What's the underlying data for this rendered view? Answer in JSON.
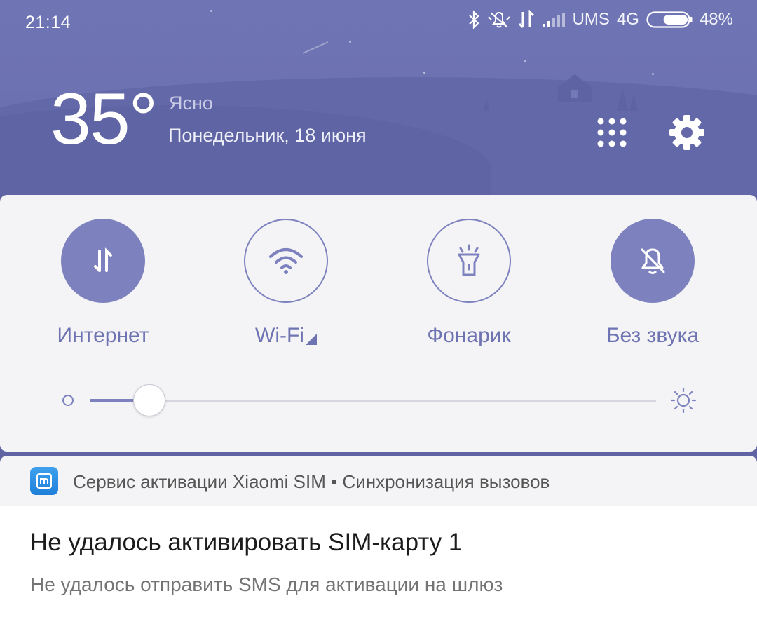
{
  "status_bar": {
    "time": "21:14",
    "carrier": "UMS",
    "network": "4G",
    "battery_percent": "48%",
    "battery_level": 0.48,
    "icons": [
      "bluetooth-icon",
      "silent-icon",
      "data-transfer-icon",
      "signal-icon",
      "battery-icon"
    ]
  },
  "weather": {
    "temperature": "35°",
    "condition": "Ясно",
    "date": "Понедельник, 18 июня"
  },
  "header_actions": {
    "icons": [
      "apps-grid-icon",
      "gear-icon"
    ]
  },
  "quick_settings": {
    "toggles": [
      {
        "label": "Интернет",
        "icon": "mobile-data-icon",
        "state": "on"
      },
      {
        "label": "Wi-Fi",
        "icon": "wifi-icon",
        "state": "off"
      },
      {
        "label": "Фонарик",
        "icon": "flashlight-icon",
        "state": "off"
      },
      {
        "label": "Без звука",
        "icon": "bell-off-icon",
        "state": "on"
      }
    ],
    "brightness": {
      "level": 0.105,
      "min_icon": "brightness-low-icon",
      "max_icon": "brightness-high-icon"
    }
  },
  "notification": {
    "app_icon": "mi-icon",
    "source": "Сервис активации Xiaomi SIM • Синхронизация вызовов",
    "title": "Не удалось активировать SIM-карту 1",
    "text": "Не удалось отправить SMS для активации на шлюз"
  },
  "colors": {
    "header": "#6d72b2",
    "accent": "#7d82bf",
    "panel": "#f4f4f6"
  }
}
